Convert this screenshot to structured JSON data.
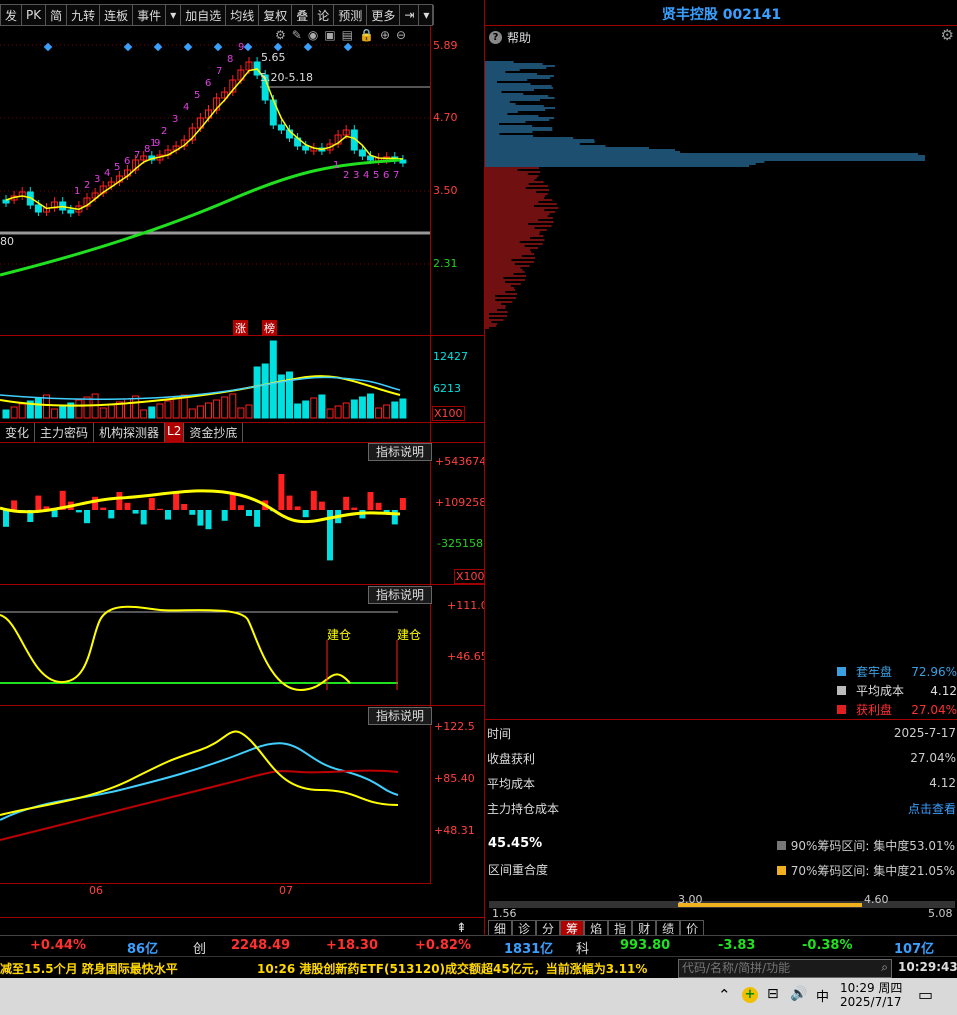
{
  "toolbar": {
    "items": [
      "发",
      "PK",
      "简",
      "九转",
      "连板",
      "事件",
      "▾",
      "加自选",
      "均线",
      "复权",
      "叠",
      "论",
      "预测",
      "更多",
      "⇥",
      "▾"
    ]
  },
  "stock": {
    "name": "贤丰控股",
    "code": "002141"
  },
  "help_label": "帮助",
  "price_axis": [
    "5.89",
    "4.70",
    "3.50",
    "2.31"
  ],
  "price_notes": {
    "high": "5.65",
    "range": "5.20-5.18",
    "left_price": "80"
  },
  "badges": [
    "涨",
    "榜"
  ],
  "volume_axis": [
    "12427",
    "6213",
    "X100"
  ],
  "tabs": [
    "变化",
    "主力密码",
    "机构探测器",
    "L2",
    "资金抄底"
  ],
  "ind_btn": "指标说明",
  "ind1_axis": [
    "+543674",
    "+109258",
    "-325158",
    "X100"
  ],
  "ind2_axis": [
    "+111.0",
    "+46.65"
  ],
  "ind2_marks": [
    "建仓",
    "建仓"
  ],
  "ind3_axis": [
    "+122.5",
    "+85.40",
    "+48.31"
  ],
  "months": [
    "06",
    "07"
  ],
  "td_buy": [
    "1",
    "2",
    "3",
    "4",
    "5",
    "6",
    "7",
    "8",
    "9"
  ],
  "td_sell": [
    "1",
    "2",
    "3",
    "4",
    "5",
    "6",
    "7",
    "8",
    "9"
  ],
  "td_tail": [
    "1",
    "2",
    "3",
    "4",
    "5",
    "6",
    "7"
  ],
  "chip_legend": [
    {
      "label": "套牢盘",
      "value": "72.96%",
      "color": "#3aa0e0"
    },
    {
      "label": "平均成本",
      "value": "4.12",
      "color": "#bbbbbb"
    },
    {
      "label": "获利盘",
      "value": "27.04%",
      "color": "#e02020"
    }
  ],
  "chip_info": [
    {
      "label": "时间",
      "value": "2025-7-17"
    },
    {
      "label": "收盘获利",
      "value": "27.04%"
    },
    {
      "label": "平均成本",
      "value": "4.12"
    },
    {
      "label": "主力持仓成本",
      "value": "点击查看"
    }
  ],
  "overlap": {
    "pct": "45.45%",
    "label": "区间重合度"
  },
  "conc": [
    {
      "label": "90%筹码区间: 集中度53.01%",
      "color": "#777777"
    },
    {
      "label": "70%筹码区间: 集中度21.05%",
      "color": "#f0b020"
    }
  ],
  "scale": {
    "min": "1.56",
    "a": "3.00",
    "b": "4.60",
    "max": "5.08"
  },
  "bottom_tabs": [
    "细",
    "诊",
    "分",
    "筹",
    "焰",
    "指",
    "财",
    "绩",
    "价"
  ],
  "index_bar": {
    "pct1": "+0.44%",
    "amt1": "86亿",
    "cy_label": "创",
    "cy_val": "2248.49",
    "cy_chg": "+18.30",
    "cy_pct": "+0.82%",
    "cy_amt": "1831亿",
    "kc_label": "科",
    "kc_val": "993.80",
    "kc_chg": "-3.83",
    "kc_pct": "-0.38%",
    "kc_amt": "107亿"
  },
  "news": {
    "left": "减至15.5个月 跻身国际最快水平",
    "center": "10:26 港股创新药ETF(513120)成交额超45亿元，当前涨幅为3.11%",
    "search_placeholder": "代码/名称/简拼/功能",
    "time": "10:29:43"
  },
  "taskbar": {
    "ime": "中",
    "time": "10:29 周四",
    "date": "2025/7/17"
  },
  "colors": {
    "up": "#ff2020",
    "down": "#00e0e0",
    "yellow": "#ffff00",
    "green": "#20e020",
    "grid": "#a00000"
  }
}
